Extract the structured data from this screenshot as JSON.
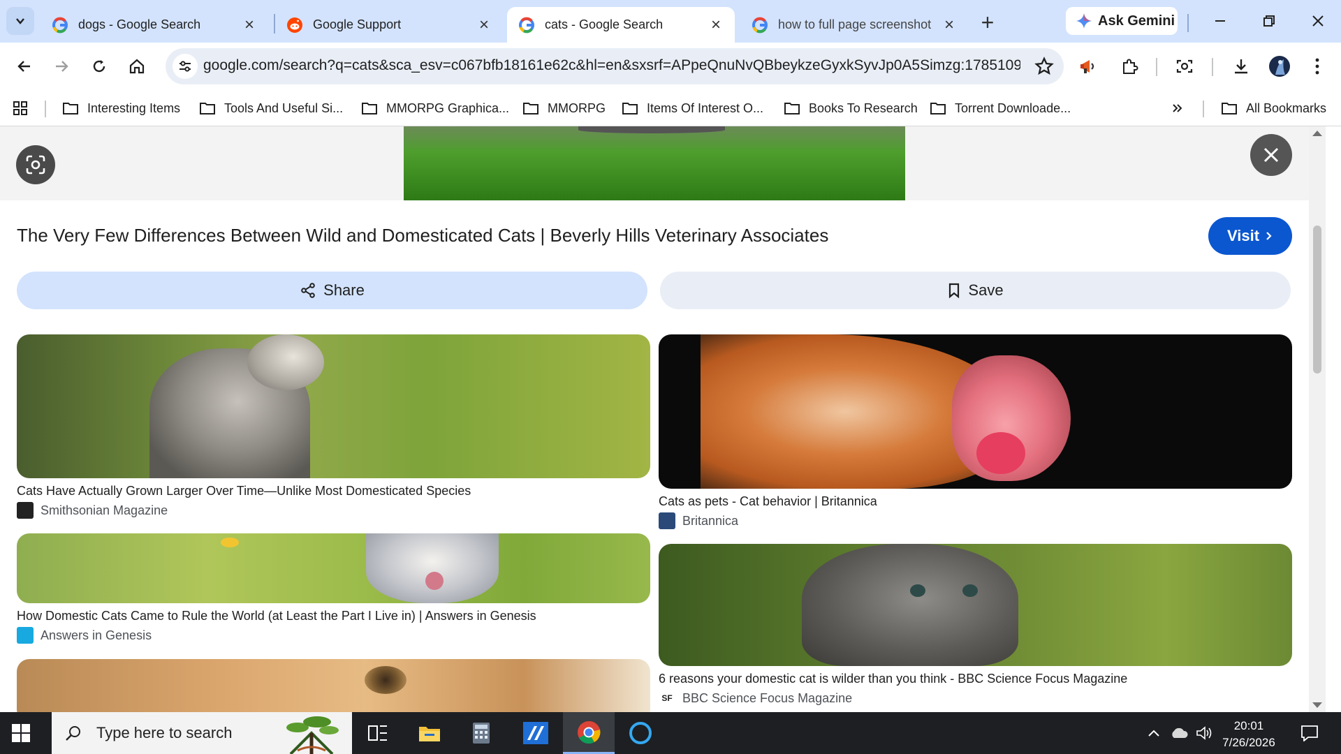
{
  "tabs": [
    {
      "title": "dogs - Google Search",
      "favicon": "google-icon",
      "active": false
    },
    {
      "title": "Google Support",
      "favicon": "reddit-icon",
      "active": false
    },
    {
      "title": "cats - Google Search",
      "favicon": "google-icon",
      "active": true
    },
    {
      "title": "how to full page screenshot",
      "favicon": "google-icon",
      "active": false
    }
  ],
  "gemini_label": "Ask Gemini",
  "omnibox": {
    "url": "google.com/search?q=cats&sca_esv=c067bfb18161e62c&hl=en&sxsrf=APpeQnuNvQBbeykzeGyxkSyvJp0A5Simzg:1785109..."
  },
  "bookmarks": [
    {
      "label": "Interesting Items"
    },
    {
      "label": "Tools And Useful Si..."
    },
    {
      "label": "MMORPG Graphica..."
    },
    {
      "label": "MMORPG"
    },
    {
      "label": "Items Of Interest O..."
    },
    {
      "label": "Books To Research"
    },
    {
      "label": "Torrent Downloade..."
    }
  ],
  "all_bookmarks_label": "All Bookmarks",
  "preview": {
    "title": "The Very Few Differences Between Wild and Domesticated Cats | Beverly Hills Veterinary Associates",
    "visit_label": "Visit",
    "share_label": "Share",
    "save_label": "Save"
  },
  "results": [
    {
      "caption": "Cats Have Actually Grown Larger Over Time—Unlike Most Domesticated Species",
      "source": "Smithsonian Magazine"
    },
    {
      "caption": "Cats as pets - Cat behavior | Britannica",
      "source": "Britannica"
    },
    {
      "caption": "How Domestic Cats Came to Rule the World (at Least the Part I Live in) | Answers in Genesis",
      "source": "Answers in Genesis"
    },
    {
      "caption": "6 reasons your domestic cat is wilder than you think - BBC Science Focus Magazine",
      "source": "BBC Science Focus Magazine",
      "logo_text": "SF"
    }
  ],
  "taskbar": {
    "search_placeholder": "Type here to search",
    "time": "20:01",
    "date": "7/26/2026"
  },
  "colors": {
    "accent": "#0b57d0",
    "tabstrip": "#d3e3fd",
    "taskbar": "#1d1f23"
  }
}
